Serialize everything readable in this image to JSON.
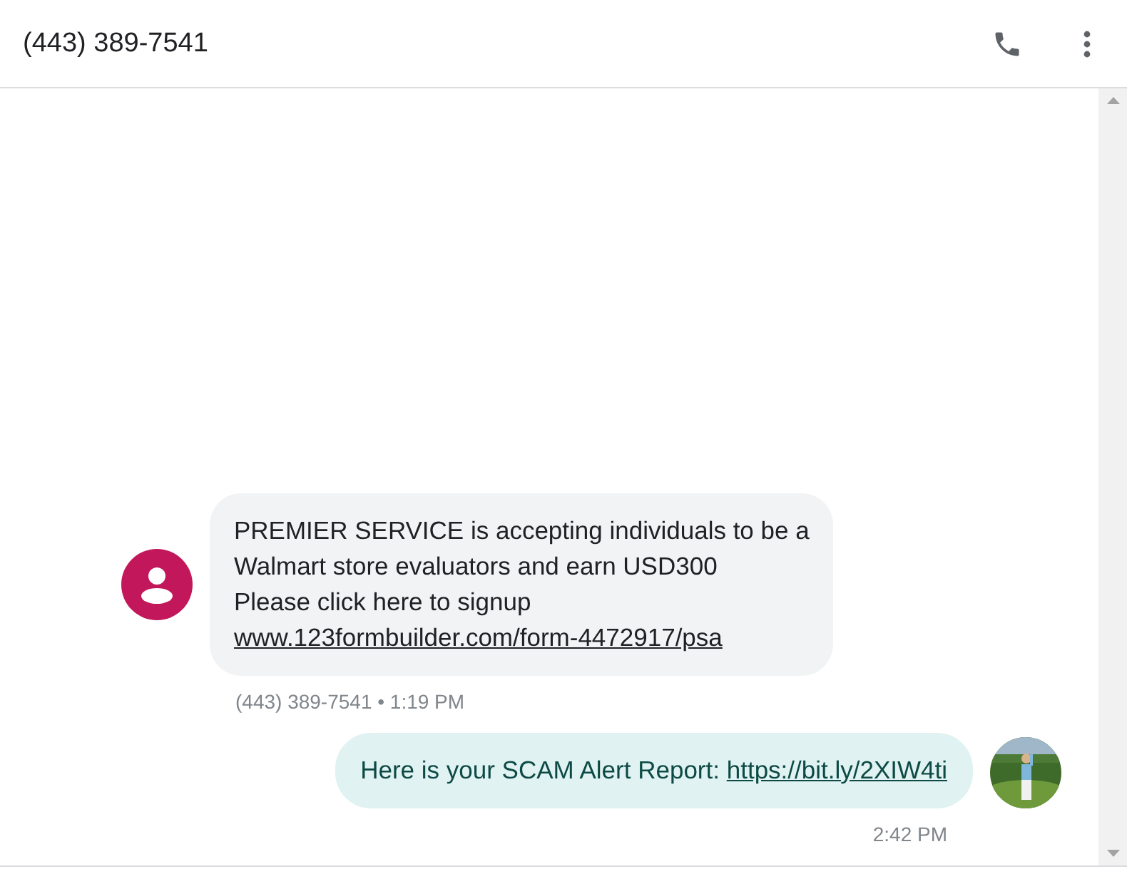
{
  "header": {
    "title": "(443) 389-7541"
  },
  "messages": [
    {
      "kind": "incoming",
      "lines": [
        "PREMIER SERVICE is accepting individuals to be a",
        "Walmart store evaluators and earn USD300",
        "Please click here to signup"
      ],
      "link": "www.123formbuilder.com/form-4472917/psa",
      "meta": "(443) 389-7541 • 1:19 PM"
    },
    {
      "kind": "outgoing",
      "lines": [
        "Here is your SCAM Alert Report:"
      ],
      "link": "https://bit.ly/2XIW4ti",
      "meta": "2:42 PM",
      "avatar": {
        "kind": "picture"
      }
    }
  ]
}
